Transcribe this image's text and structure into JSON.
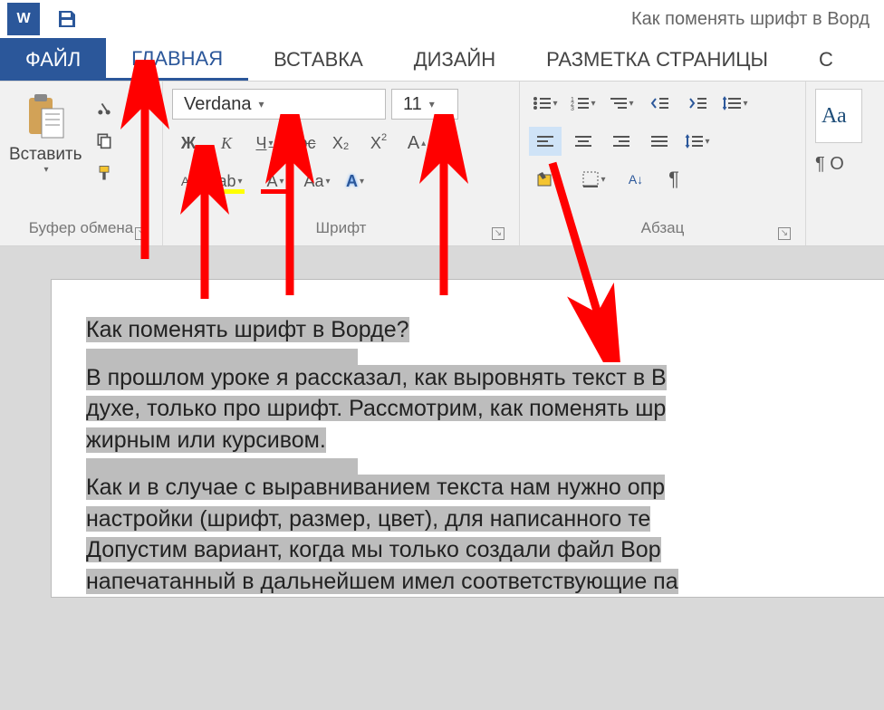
{
  "titlebar": {
    "app_glyph": "W",
    "doc_title": "Как поменять шрифт в Ворд"
  },
  "tabs": {
    "file": "ФАЙЛ",
    "home": "ГЛАВНАЯ",
    "insert": "ВСТАВКА",
    "design": "ДИЗАЙН",
    "pagelayout": "РАЗМЕТКА СТРАНИЦЫ",
    "more": "С"
  },
  "ribbon": {
    "clipboard": {
      "paste": "Вставить",
      "label": "Буфер обмена"
    },
    "font": {
      "name": "Verdana",
      "size": "11",
      "bold": "Ж",
      "italic": "К",
      "underline": "Ч",
      "strike": "abc",
      "sub_glyph": "X",
      "sup_glyph": "X",
      "grow": "A",
      "shrink": "A",
      "case": "Aa",
      "clear": "▱",
      "highlight_glyph": "ab",
      "fontcolor_glyph": "A",
      "label": "Шрифт"
    },
    "paragraph": {
      "label": "Абзац",
      "sort_glyph": "A↓",
      "pilcrow": "¶"
    },
    "styles": {
      "sample": "Аа",
      "pilcrow_label": "¶ О"
    }
  },
  "document": {
    "heading": "Как поменять шрифт в Ворде?",
    "p1_l1": "В прошлом уроке я рассказал, как выровнять текст в В",
    "p1_l2": "духе, только про шрифт. Рассмотрим, как поменять шр",
    "p1_l3": "жирным или курсивом.",
    "p2_l1": "Как и в случае с выравниванием текста нам нужно опр",
    "p2_l2": "настройки (шрифт, размер, цвет), для написанного те",
    "p2_l3": "Допустим вариант, когда мы только создали файл Вор",
    "p2_l4": "напечатанный в дальнейшем имел соответствующие па"
  }
}
